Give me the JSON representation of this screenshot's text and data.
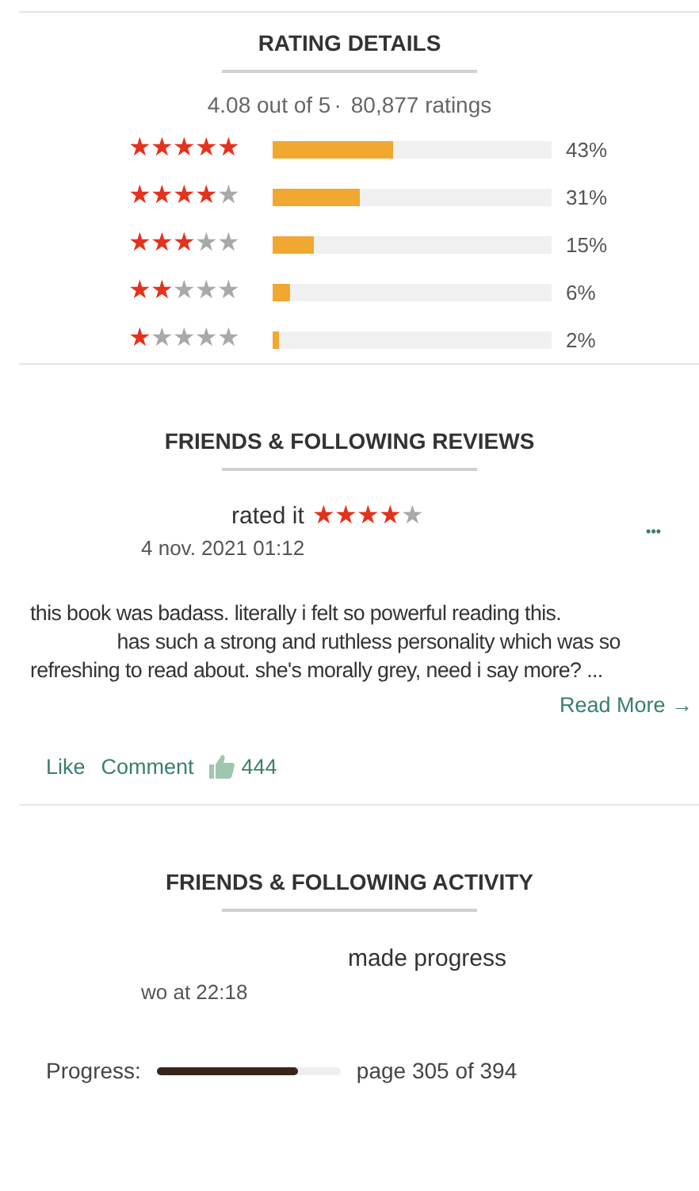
{
  "rating_details": {
    "title": "RATING DETAILS",
    "average": "4.08 out of 5",
    "separator": "·",
    "count": "80,877 ratings",
    "rows": [
      {
        "stars": 5,
        "level": 0.43,
        "percent": "43%"
      },
      {
        "stars": 4,
        "level": 0.31,
        "percent": "31%"
      },
      {
        "stars": 3,
        "level": 0.15,
        "percent": "15%"
      },
      {
        "stars": 2,
        "level": 0.06,
        "percent": "6%"
      },
      {
        "stars": 1,
        "level": 0.02,
        "percent": "2%"
      }
    ]
  },
  "reviews": {
    "title": "FRIENDS & FOLLOWING REVIEWS",
    "rated_label": "rated it",
    "stars": 4,
    "date": "4 nov. 2021 01:12",
    "more_glyph": "•••",
    "text": "this book was badass. literally i felt so powerful reading this.                 has such a strong and ruthless personality which was so refreshing to read about. she's morally grey, need i say more? ...",
    "read_more": "Read More",
    "read_more_arrow": "→",
    "actions": [
      "Like",
      "Comment"
    ],
    "likes": "444"
  },
  "activity": {
    "title": "FRIENDS & FOLLOWING ACTIVITY",
    "action": "made progress",
    "time": "wo at 22:18",
    "progress_label": "Progress:",
    "level": 0.77,
    "page_text": "page 305 of 394"
  }
}
